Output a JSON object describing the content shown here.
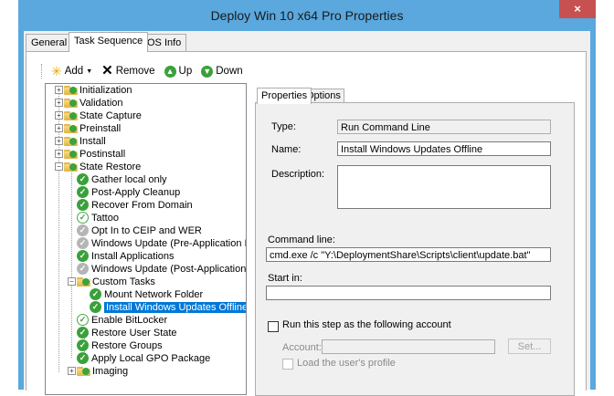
{
  "window": {
    "title": "Deploy Win 10 x64 Pro Properties",
    "close_glyph": "×"
  },
  "tabs": [
    {
      "label": "General"
    },
    {
      "label": "Task Sequence"
    },
    {
      "label": "OS Info"
    }
  ],
  "toolbar": {
    "add": "Add",
    "remove": "Remove",
    "up": "Up",
    "down": "Down"
  },
  "tree": {
    "nodes": [
      "Initialization",
      "Validation",
      "State Capture",
      "Preinstall",
      "Install",
      "Postinstall",
      "State Restore",
      "Gather local only",
      "Post-Apply Cleanup",
      "Recover From Domain",
      "Tattoo",
      "Opt In to CEIP and WER",
      "Windows Update (Pre-Application Installa",
      "Install Applications",
      "Windows Update (Post-Application Install",
      "Custom Tasks",
      "Mount Network Folder",
      "Install Windows Updates Offline",
      "Enable BitLocker",
      "Restore User State",
      "Restore Groups",
      "Apply Local GPO Package",
      "Imaging"
    ]
  },
  "properties": {
    "tabs": {
      "properties": "Properties",
      "options": "Options"
    },
    "type_label": "Type:",
    "type_value": "Run Command Line",
    "name_label": "Name:",
    "name_value": "Install Windows Updates Offline",
    "description_label": "Description:",
    "description_value": "",
    "command_line_label": "Command line:",
    "command_line_value": "cmd.exe /c \"Y:\\DeploymentShare\\Scripts\\client\\update.bat\"",
    "start_in_label": "Start in:",
    "start_in_value": "",
    "run_as_label": "Run this step as the following account",
    "account_label": "Account:",
    "account_value": "",
    "set_button": "Set...",
    "load_profile_label": "Load the user's profile"
  },
  "colors": {
    "titlebar": "#5aa8de",
    "close": "#c75050",
    "selection": "#0078d7",
    "step_ok": "#3aa13a"
  }
}
